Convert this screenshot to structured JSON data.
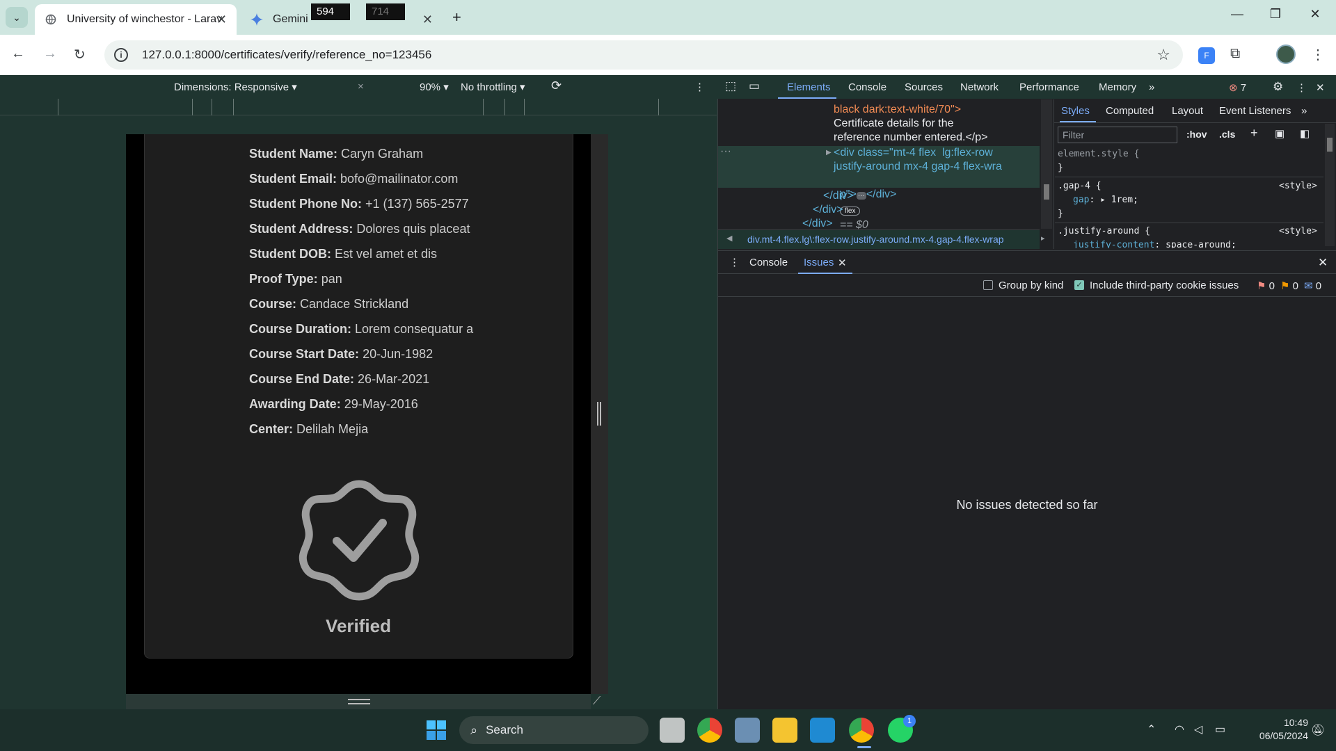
{
  "browser": {
    "tabs": [
      {
        "label": "University of winchestor - Larav",
        "active": true
      },
      {
        "label": "Gemini",
        "active": false
      }
    ],
    "url": "127.0.0.1:8000/certificates/verify/reference_no=123456"
  },
  "device_toolbar": {
    "dimensions_label": "Dimensions: Responsive",
    "width": "594",
    "height_placeholder": "714",
    "zoom": "90%",
    "throttling": "No throttling"
  },
  "certificate": {
    "fields": [
      {
        "label": "Student Name:",
        "value": "Caryn Graham"
      },
      {
        "label": "Student Email:",
        "value": "bofo@mailinator.com"
      },
      {
        "label": "Student Phone No:",
        "value": "+1 (137) 565-2577"
      },
      {
        "label": "Student Address:",
        "value": "Dolores quis placeat"
      },
      {
        "label": "Student DOB:",
        "value": "Est vel amet et dis"
      },
      {
        "label": "Proof Type:",
        "value": "pan"
      },
      {
        "label": "Course:",
        "value": "Candace Strickland"
      },
      {
        "label": "Course Duration:",
        "value": "Lorem consequatur a"
      },
      {
        "label": "Course Start Date:",
        "value": "20-Jun-1982"
      },
      {
        "label": "Course End Date:",
        "value": "26-Mar-2021"
      },
      {
        "label": "Awarding Date:",
        "value": "29-May-2016"
      },
      {
        "label": "Center:",
        "value": "Delilah Mejia"
      }
    ],
    "status": "Verified"
  },
  "devtools": {
    "tabs": [
      "Elements",
      "Console",
      "Sources",
      "Network",
      "Performance",
      "Memory"
    ],
    "error_count": "7",
    "dom": {
      "line1": "black dark:text-white/70\">",
      "line2": "Certificate details for the",
      "line3": "reference number entered.</p>",
      "sel1": "<div class=\"mt-4 flex  lg:flex-row",
      "sel2": "justify-around mx-4 gap-4 flex-wra",
      "sel3": "p\">",
      "sel_tail": "</div>",
      "flex_badge": "flex",
      "sel_eq": "== $0",
      "close1": "</div>",
      "close2": "</div>",
      "close3": "</div>"
    },
    "breadcrumb": "div.mt-4.flex.lg\\:flex-row.justify-around.mx-4.gap-4.flex-wrap",
    "styles_tabs": [
      "Styles",
      "Computed",
      "Layout",
      "Event Listeners"
    ],
    "filter_placeholder": "Filter",
    "hov": ":hov",
    "cls": ".cls",
    "css": {
      "rule0": "element.style {",
      "rule0_close": "}",
      "rule1_sel": ".gap-4 {",
      "rule1_prop": "gap",
      "rule1_val": "1rem;",
      "rule1_close": "}",
      "rule1_src": "<style>",
      "rule2_sel": ".justify-around {",
      "rule2_prop": "justify-content",
      "rule2_val": "space-around;",
      "rule2_src": "<style>"
    },
    "drawer_tabs": [
      "Console",
      "Issues"
    ],
    "group_by_kind": "Group by kind",
    "include_third_party": "Include third-party cookie issues",
    "issue_counts": [
      "0",
      "0",
      "0"
    ],
    "no_issues": "No issues detected so far"
  },
  "taskbar": {
    "search": "Search",
    "time": "10:49",
    "date": "06/05/2024",
    "whatsapp_badge": "1"
  }
}
